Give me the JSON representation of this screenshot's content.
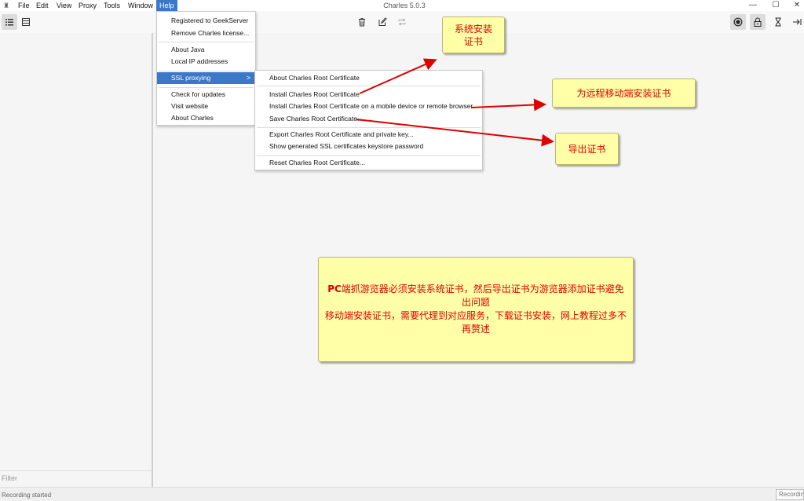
{
  "window": {
    "title": "Charles 5.0.3",
    "minimize": "—",
    "maximize": "☐",
    "close": "✕"
  },
  "menubar": [
    "File",
    "Edit",
    "View",
    "Proxy",
    "Tools",
    "Window",
    "Help"
  ],
  "help_menu": {
    "items": [
      "Registered to GeekServer",
      "Remove Charles license...",
      "About Java",
      "Local IP addresses",
      "SSL proxying",
      "Check for updates",
      "Visit website",
      "About Charles"
    ],
    "submenu_arrow": ">"
  },
  "ssl_submenu": {
    "items": [
      "About Charles Root Certificate",
      "Install Charles Root Certificate",
      "Install Charles Root Certificate on a mobile device or remote browser",
      "Save Charles Root Certificate...",
      "Export Charles Root Certificate and private key...",
      "Show generated SSL certificates keystore password",
      "Reset Charles Root Certificate..."
    ]
  },
  "annotations": {
    "system_install": "系统安装\n证书",
    "remote_install": "为远程移动端安装证书",
    "export": "导出证书",
    "note_prefix": "PC",
    "note_rest": "端抓游览器必须安装系统证书，然后导出证书为游览器添加证书避免出问题\n移动端安装证书，需要代理到对应服务，下载证书安装，网上教程过多不再赘述"
  },
  "filter_label": "Filter",
  "status": {
    "text": "Recording started",
    "button": "Recording"
  },
  "colors": {
    "menu_highlight": "#3c78c8",
    "note_bg": "#ffffa8",
    "annotation_red": "#e00000"
  }
}
